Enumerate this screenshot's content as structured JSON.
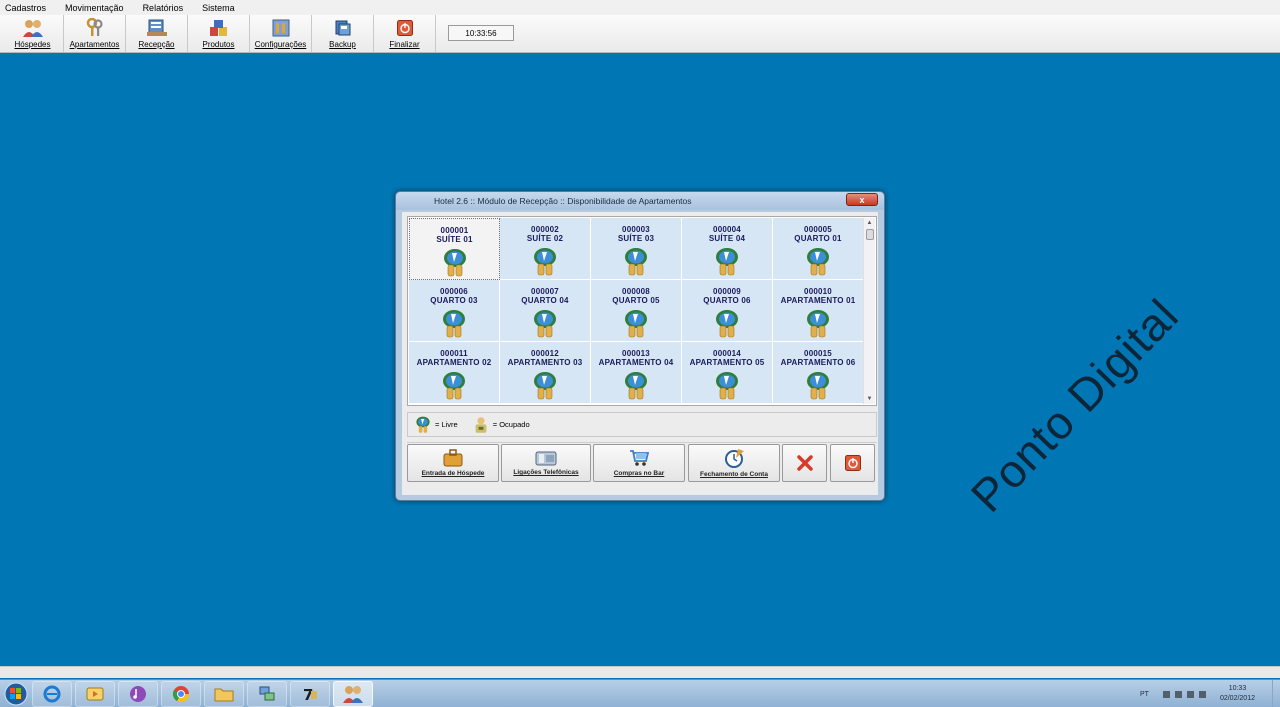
{
  "menu": [
    "Cadastros",
    "Movimentação",
    "Relatórios",
    "Sistema"
  ],
  "toolbar": {
    "buttons": [
      {
        "label": "Hóspedes",
        "icon": "guests-icon"
      },
      {
        "label": "Apartamentos",
        "icon": "keys-icon"
      },
      {
        "label": "Recepção",
        "icon": "reception-icon"
      },
      {
        "label": "Produtos",
        "icon": "products-icon"
      },
      {
        "label": "Configurações",
        "icon": "settings-icon"
      },
      {
        "label": "Backup",
        "icon": "backup-icon"
      },
      {
        "label": "Finalizar",
        "icon": "power-icon"
      }
    ],
    "clock": "10:33:56"
  },
  "dialog": {
    "title": "Hotel 2.6  ::  Módulo de Recepção  ::  Disponibilidade de Apartamentos",
    "close": "x",
    "rooms": [
      {
        "num": "000001",
        "name": "SUÍTE 01",
        "status": "livre"
      },
      {
        "num": "000002",
        "name": "SUÍTE 02",
        "status": "livre"
      },
      {
        "num": "000003",
        "name": "SUÍTE 03",
        "status": "livre"
      },
      {
        "num": "000004",
        "name": "SUÍTE 04",
        "status": "livre"
      },
      {
        "num": "000005",
        "name": "QUARTO 01",
        "status": "livre"
      },
      {
        "num": "000006",
        "name": "QUARTO 03",
        "status": "livre"
      },
      {
        "num": "000007",
        "name": "QUARTO 04",
        "status": "livre"
      },
      {
        "num": "000008",
        "name": "QUARTO 05",
        "status": "livre"
      },
      {
        "num": "000009",
        "name": "QUARTO 06",
        "status": "livre"
      },
      {
        "num": "000010",
        "name": "APARTAMENTO 01",
        "status": "livre"
      },
      {
        "num": "000011",
        "name": "APARTAMENTO 02",
        "status": "livre"
      },
      {
        "num": "000012",
        "name": "APARTAMENTO 03",
        "status": "livre"
      },
      {
        "num": "000013",
        "name": "APARTAMENTO 04",
        "status": "livre"
      },
      {
        "num": "000014",
        "name": "APARTAMENTO 05",
        "status": "livre"
      },
      {
        "num": "000015",
        "name": "APARTAMENTO 06",
        "status": "livre"
      }
    ],
    "legend": {
      "livre": "= Livre",
      "ocupado": "= Ocupado"
    },
    "actions": {
      "entrada": "Entrada de Hóspede",
      "ligacoes": "Ligações Telefônicas",
      "compras": "Compras no Bar",
      "fechamento": "Fechamento de Conta"
    }
  },
  "watermark": "Ponto Digital",
  "taskbar": {
    "lang": "PT",
    "time": "10:33",
    "date": "02/02/2012"
  },
  "colors": {
    "desktop": "#0077b4",
    "cell": "#d7e6f4",
    "room_text": "#1a1a5c"
  }
}
